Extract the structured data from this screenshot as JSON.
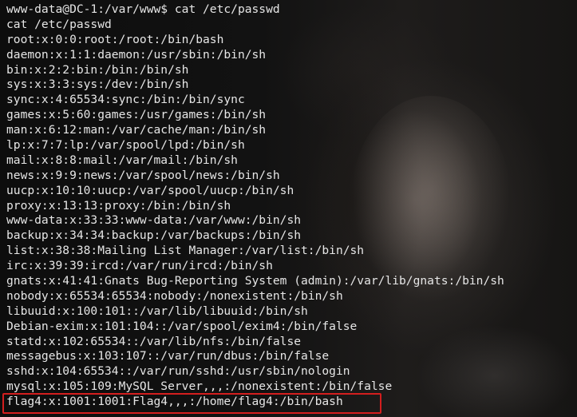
{
  "terminal": {
    "lines": [
      "www-data@DC-1:/var/www$ cat /etc/passwd",
      "cat /etc/passwd",
      "root:x:0:0:root:/root:/bin/bash",
      "daemon:x:1:1:daemon:/usr/sbin:/bin/sh",
      "bin:x:2:2:bin:/bin:/bin/sh",
      "sys:x:3:3:sys:/dev:/bin/sh",
      "sync:x:4:65534:sync:/bin:/bin/sync",
      "games:x:5:60:games:/usr/games:/bin/sh",
      "man:x:6:12:man:/var/cache/man:/bin/sh",
      "lp:x:7:7:lp:/var/spool/lpd:/bin/sh",
      "mail:x:8:8:mail:/var/mail:/bin/sh",
      "news:x:9:9:news:/var/spool/news:/bin/sh",
      "uucp:x:10:10:uucp:/var/spool/uucp:/bin/sh",
      "proxy:x:13:13:proxy:/bin:/bin/sh",
      "www-data:x:33:33:www-data:/var/www:/bin/sh",
      "backup:x:34:34:backup:/var/backups:/bin/sh",
      "list:x:38:38:Mailing List Manager:/var/list:/bin/sh",
      "irc:x:39:39:ircd:/var/run/ircd:/bin/sh",
      "gnats:x:41:41:Gnats Bug-Reporting System (admin):/var/lib/gnats:/bin/sh",
      "nobody:x:65534:65534:nobody:/nonexistent:/bin/sh",
      "libuuid:x:100:101::/var/lib/libuuid:/bin/sh",
      "Debian-exim:x:101:104::/var/spool/exim4:/bin/false",
      "statd:x:102:65534::/var/lib/nfs:/bin/false",
      "messagebus:x:103:107::/var/run/dbus:/bin/false",
      "sshd:x:104:65534::/var/run/sshd:/usr/sbin/nologin",
      "mysql:x:105:109:MySQL Server,,,:/nonexistent:/bin/false",
      "flag4:x:1001:1001:Flag4,,,:/home/flag4:/bin/bash"
    ],
    "highlighted_line": "flag4:x:1001:1001:Flag4,,,:/home/flag4:/bin/bash",
    "highlight_color": "#d31e1e",
    "text_color": "#e6e6e6",
    "background_color": "#0c0c0c"
  }
}
